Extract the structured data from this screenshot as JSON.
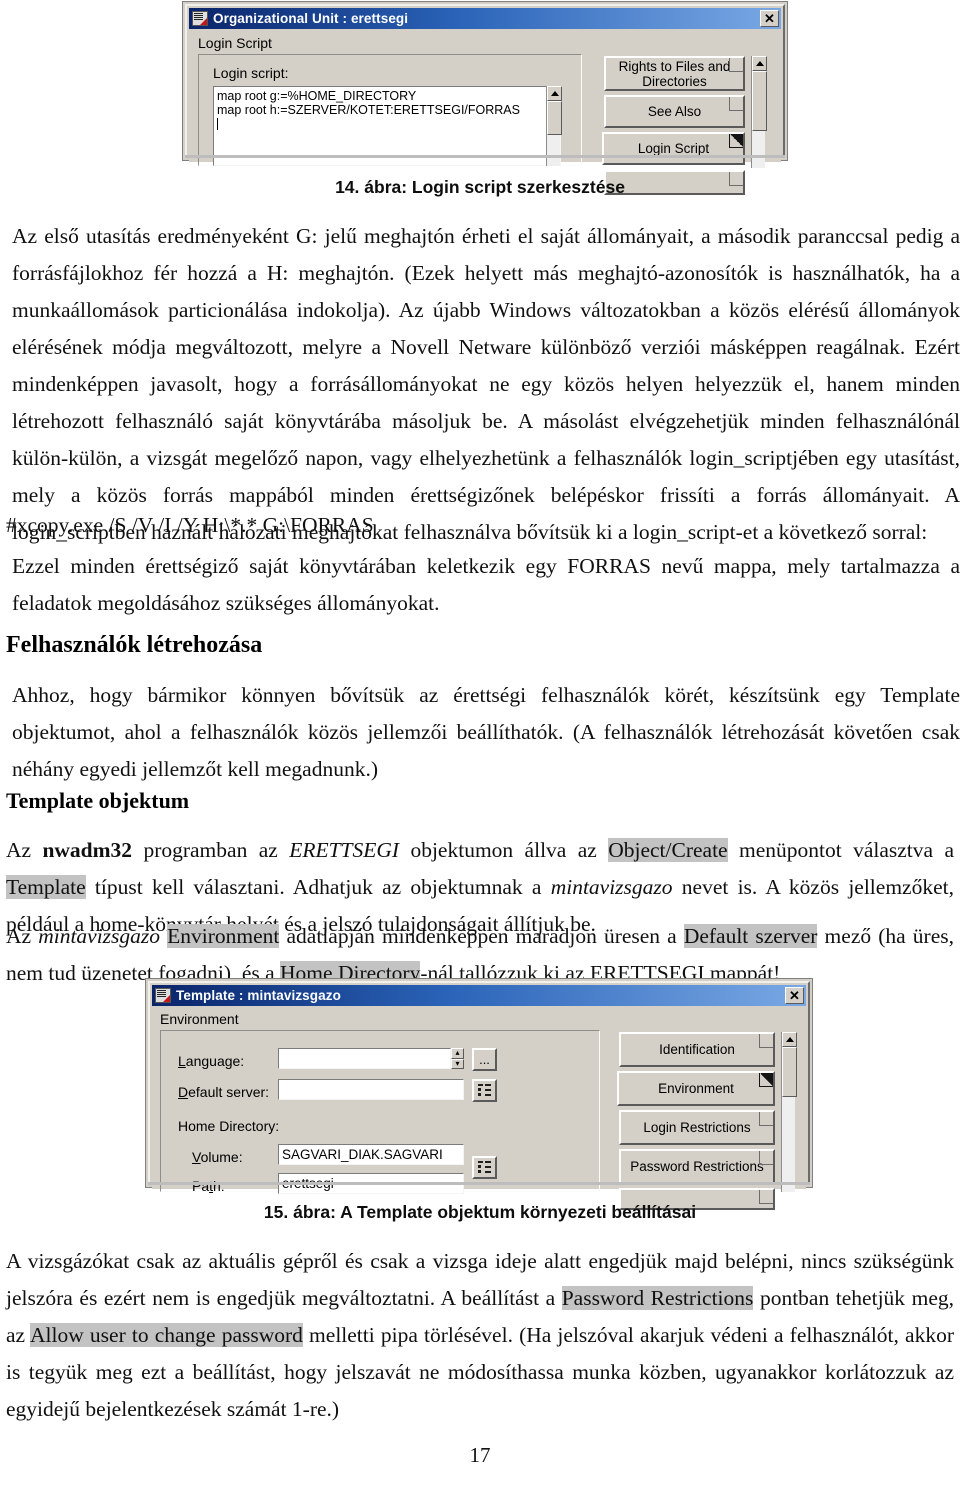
{
  "page": {
    "number": "17"
  },
  "figure14": {
    "caption": "14. ábra: Login script szerkesztése",
    "dialog": {
      "title": "Organizational Unit : erettsegi",
      "close_label": "✕",
      "group_label": "Login Script",
      "field_label": "Login script:",
      "script_lines": [
        "map root g:=%HOME_DIRECTORY",
        "map root h:=SZERVER/KOTET:ERETTSEGI/FORRAS"
      ],
      "page_buttons": [
        {
          "label": "Rights to Files and Directories",
          "selected": false
        },
        {
          "label": "See Also",
          "selected": false
        },
        {
          "label": "Login Script",
          "selected": true
        }
      ]
    }
  },
  "figure15": {
    "caption": "15. ábra: A Template objektum környezeti beállításai",
    "dialog": {
      "title": "Template : mintavizsgazo",
      "close_label": "✕",
      "group_label": "Environment",
      "fields": [
        {
          "label": "Language:",
          "underline": "L",
          "value": ""
        },
        {
          "label": "Default server:",
          "underline": "D",
          "value": ""
        }
      ],
      "home_directory_label": "Home Directory:",
      "home_fields": [
        {
          "label": "Volume:",
          "underline": "V",
          "value": "SAGVARI_DIAK.SAGVARI"
        },
        {
          "label": "Path:",
          "underline": "t",
          "value": "erettsegi"
        }
      ],
      "ellipsis_button": "...",
      "page_buttons": [
        {
          "label": "Identification",
          "selected": false
        },
        {
          "label": "Environment",
          "selected": true
        },
        {
          "label": "Login Restrictions",
          "selected": false
        },
        {
          "label": "Password Restrictions",
          "selected": false
        }
      ]
    }
  },
  "body": {
    "p1": "Az első utasítás eredményeként G: jelű meghajtón érheti el saját állományait, a második paranccsal pedig a forrásfájlokhoz fér hozzá a H: meghajtón. (Ezek helyett más meghajtó-azonosítók is használhatók, ha a munkaállomások particionálása indokolja). Az újabb Windows változatokban a közös elérésű állományok elérésének módja megváltozott, melyre a Novell Netware különböző verziói másképpen reagálnak. Ezért mindenképpen javasolt, hogy a forrásállományokat ne egy közös helyen helyezzük el, hanem minden létrehozott felhasználó saját könyvtárába másoljuk be. A másolást elvégzehetjük minden felhasználónál külön-külön, a vizsgát megelőző napon, vagy elhelyezhetünk a felhasználók login_scriptjében egy utasítást, mely a közös forrás mappából minden érettségizőnek belépéskor frissíti a forrás állományait. A login_scriptben haznált hálózati meghajtókat felhasználva bővítsük ki a login_script-et a következő sorral:",
    "code": "#xcopy.exe /S /V /I /Y H:\\*.* G:\\FORRAS",
    "p2": "Ezzel minden érettségiző saját könyvtárában keletkezik egy FORRAS nevű mappa, mely tartalmazza a feladatok megoldásához szükséges állományokat.",
    "h_felhasznalok": "Felhasználók létrehozása",
    "p3": "Ahhoz, hogy bármikor könnyen bővítsük az érettségi felhasználók körét, készítsünk egy Template objektumot, ahol a felhasználók közös jellemzői beállíthatók. (A felhasználók létrehozását követően csak néhány egyedi jellemzőt kell megadnunk.)",
    "h_template": "Template objektum",
    "p4_a": "Az ",
    "p4_nwadm": "nwadm32",
    "p4_b": " programban az ",
    "p4_erettsegi": "ERETTSEGI",
    "p4_c": " objektumon állva az ",
    "p4_objcreate": "Object/Create",
    "p4_d": " menüpontot választva a ",
    "p4_templ": "Template",
    "p4_e": " típust kell választani. Adhatjuk az objektumnak a ",
    "p4_minta": "mintavizsgazo",
    "p4_f": " nevet is. A közös jellemzőket, például a home-könyvtár helyét és a jelszó tulajdonságait állítjuk be.",
    "p5_a": "Az ",
    "p5_minta": "mintavizsgazo",
    "p5_b": " ",
    "p5_env": "Environment",
    "p5_c": " adatlapján mindenképpen maradjon üresen a ",
    "p5_default": "Default szerver",
    "p5_d": " mező (ha üres, nem tud üzenetet fogadni), és a ",
    "p5_home": "Home Directory",
    "p5_e": "-nál tallózzuk ki az ERETTSEGI mappát!",
    "p6_a": "A vizsgázókat csak az aktuális gépről és csak a vizsga ideje alatt engedjük majd belépni, nincs szükségünk jelszóra és ezért nem is engedjük megváltoztatni. A beállítást a ",
    "p6_pwres": "Password Restrictions",
    "p6_b": " pontban tehetjük meg, az ",
    "p6_allow": "Allow user to change password",
    "p6_c": " melletti pipa törlésével. (Ha jelszóval akarjuk védeni a felhasználót, akkor is tegyük meg ezt a beállítást, hogy jelszavát ne módosíthassa munka közben, ugyanakkor korlátozzuk az egyidejű bejelentkezések számát 1-re.)"
  }
}
